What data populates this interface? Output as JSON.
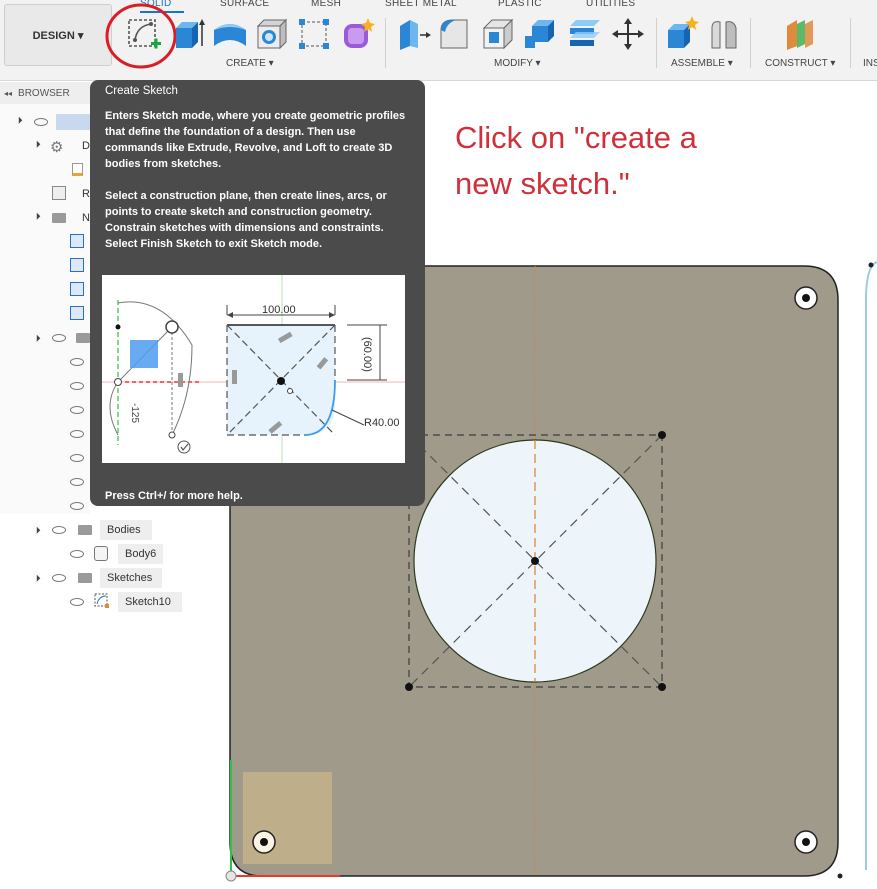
{
  "toolbar": {
    "design_label": "DESIGN ▾",
    "tabs": [
      "SOLID",
      "SURFACE",
      "MESH",
      "SHEET METAL",
      "PLASTIC",
      "UTILITIES"
    ],
    "groups": {
      "create": "CREATE ▾",
      "modify": "MODIFY ▾",
      "assemble": "ASSEMBLE ▾",
      "construct": "CONSTRUCT ▾",
      "insert": "INS"
    }
  },
  "browser": {
    "header": "BROWSER",
    "rows": {
      "row_d": "D",
      "row_r": "R",
      "row_n": "N",
      "bodies": "Bodies",
      "body6": "Body6",
      "sketches": "Sketches",
      "sketch10": "Sketch10"
    }
  },
  "tooltip": {
    "title": "Create Sketch",
    "para1": "Enters Sketch mode, where you create geometric profiles that define the foundation of a design. Then use commands like Extrude, Revolve, and Loft to create 3D bodies from sketches.",
    "para2": "Select a construction plane, then create lines, arcs, or points to create sketch and construction geometry. Constrain sketches with dimensions and constraints. Select Finish Sketch to exit Sketch mode.",
    "footer": "Press Ctrl+/ for more help.",
    "image": {
      "dim_width": "100.00",
      "dim_height": "(60.00)",
      "dim_radius": "R40.00",
      "dim_small": "-125"
    }
  },
  "annotation": {
    "line1": "Click on \"create a",
    "line2": "new sketch.\""
  },
  "colors": {
    "highlight_circle": "#d91f26",
    "annotation_text": "#d0303a",
    "tooltip_bg": "#4b4b4b",
    "plate": "#a09a8b",
    "circle_fill": "#eef5fa",
    "axis_orange": "#d9802b"
  }
}
